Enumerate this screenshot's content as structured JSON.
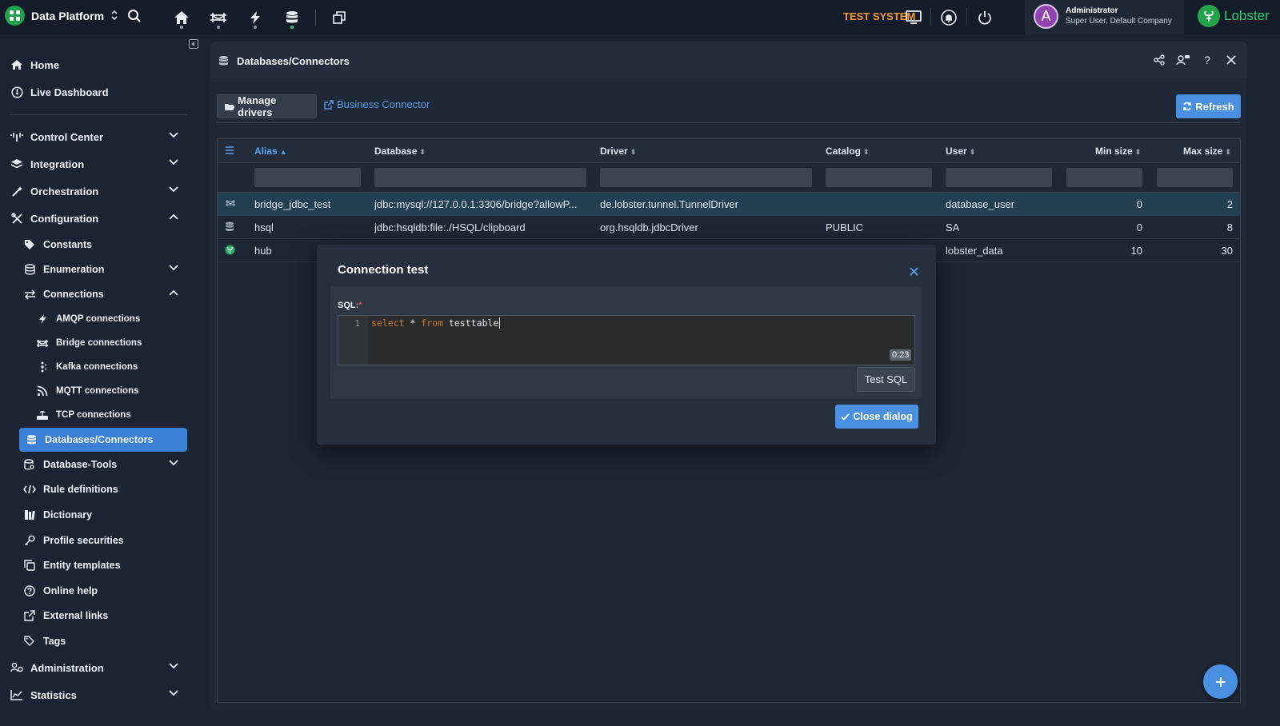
{
  "app": {
    "name": "Data Platform",
    "test_system": "TEST SYSTEM",
    "user_initial": "A",
    "user_name": "Administrator",
    "user_role": "Super User, Default Company",
    "vendor": "Lobster"
  },
  "sidebar": {
    "home": "Home",
    "live_dashboard": "Live Dashboard",
    "control_center": "Control Center",
    "integration": "Integration",
    "orchestration": "Orchestration",
    "configuration": "Configuration",
    "constants": "Constants",
    "enumeration": "Enumeration",
    "connections": "Connections",
    "amqp": "AMQP connections",
    "bridge": "Bridge connections",
    "kafka": "Kafka connections",
    "mqtt": "MQTT connections",
    "tcp": "TCP connections",
    "databases": "Databases/Connectors",
    "database_tools": "Database-Tools",
    "rule_definitions": "Rule definitions",
    "dictionary": "Dictionary",
    "profile_securities": "Profile securities",
    "entity_templates": "Entity templates",
    "online_help": "Online help",
    "external_links": "External links",
    "tags": "Tags",
    "administration": "Administration",
    "statistics": "Statistics"
  },
  "panel": {
    "title": "Databases/Connectors",
    "manage_drivers": "Manage drivers",
    "business_connector": "Business Connector",
    "refresh": "Refresh"
  },
  "grid": {
    "columns": {
      "alias": "Alias",
      "database": "Database",
      "driver": "Driver",
      "catalog": "Catalog",
      "user": "User",
      "min_size": "Min size",
      "max_size": "Max size"
    },
    "rows": [
      {
        "alias": "bridge_jdbc_test",
        "database": "jdbc:mysql://127.0.0.1:3306/bridge?allowP...",
        "driver": "de.lobster.tunnel.TunnelDriver",
        "catalog": "",
        "user": "database_user",
        "min": "0",
        "max": "2"
      },
      {
        "alias": "hsql",
        "database": "jdbc:hsqldb:file:./HSQL/clipboard",
        "driver": "org.hsqldb.jdbcDriver",
        "catalog": "PUBLIC",
        "user": "SA",
        "min": "0",
        "max": "8"
      },
      {
        "alias": "hub",
        "database": "",
        "driver": "",
        "catalog": "",
        "user": "lobster_data",
        "min": "10",
        "max": "30"
      }
    ]
  },
  "dialog": {
    "title": "Connection test",
    "sql_label": "SQL:",
    "required_mark": "*",
    "line_number": "1",
    "code_select": "select",
    "code_star": " * ",
    "code_from": "from",
    "code_table": " testtable",
    "cursor_pos": "0:23",
    "test_sql": "Test SQL",
    "close_dialog": "Close dialog"
  },
  "colors": {
    "accent": "#4a90e2",
    "brand_green": "#2ecc71",
    "test_system": "#f39c30"
  }
}
